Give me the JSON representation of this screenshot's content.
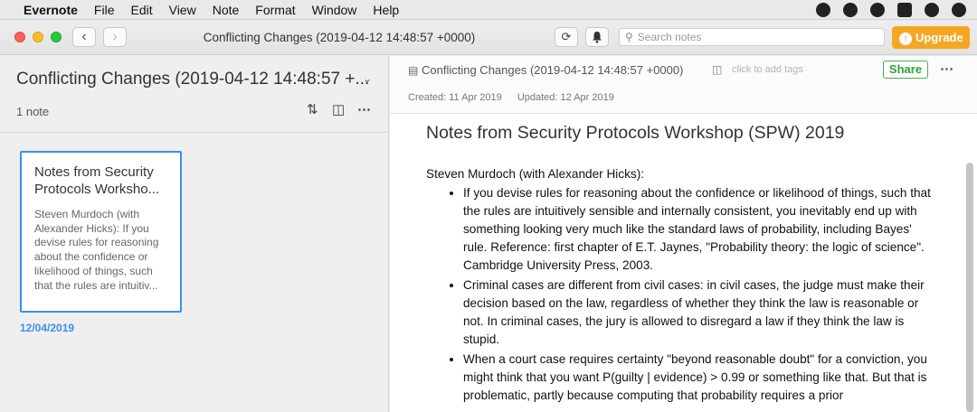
{
  "menubar": {
    "app_name": "Evernote",
    "items": [
      "File",
      "Edit",
      "View",
      "Note",
      "Format",
      "Window",
      "Help"
    ]
  },
  "toolbar": {
    "back_icon": "chevron-left-icon",
    "forward_icon": "chevron-right-icon",
    "window_title": "Conflicting Changes (2019-04-12 14:48:57 +0000)",
    "search_placeholder": "Search notes",
    "upgrade_label": "Upgrade"
  },
  "note_list": {
    "notebook_title": "Conflicting Changes (2019-04-12 14:48:57 +...",
    "note_count": "1 note",
    "card": {
      "title": "Notes from Security Protocols Worksho...",
      "snippet": "Steven Murdoch (with Alexander Hicks): If you devise rules for reasoning about the confidence or likelihood of things, such that the rules are intuitiv...",
      "date": "12/04/2019"
    }
  },
  "editor": {
    "notebook_name": "Conflicting Changes (2019-04-12 14:48:57 +0000)",
    "tag_placeholder": "click to add tags",
    "share_label": "Share",
    "created": "Created: 11 Apr 2019",
    "updated": "Updated: 12 Apr 2019",
    "heading": "Notes from Security Protocols Workshop (SPW) 2019",
    "author_line": "Steven Murdoch (with Alexander Hicks):",
    "bullets": [
      "If you devise rules for reasoning about the confidence or likelihood of things, such that the rules are intuitively sensible and internally consistent, you inevitably end up with something looking very much like the standard laws of probability, including Bayes' rule. Reference: first chapter of E.T. Jaynes, \"Probability theory: the logic of science\". Cambridge University Press, 2003.",
      "Criminal cases are different from civil cases: in civil cases, the judge must make their decision based on the law, regardless of whether they think the law is reasonable or not. In criminal cases, the jury is allowed to disregard a law if they think the law is stupid.",
      "When a court case requires certainty \"beyond reasonable doubt\" for a conviction, you might think that you want P(guilty | evidence) > 0.99 or something like that. But that is problematic, partly because computing that probability requires a prior"
    ]
  },
  "colors": {
    "accent": "#3b8ff0",
    "upgrade": "#f5a623",
    "share": "#2e9e37"
  }
}
